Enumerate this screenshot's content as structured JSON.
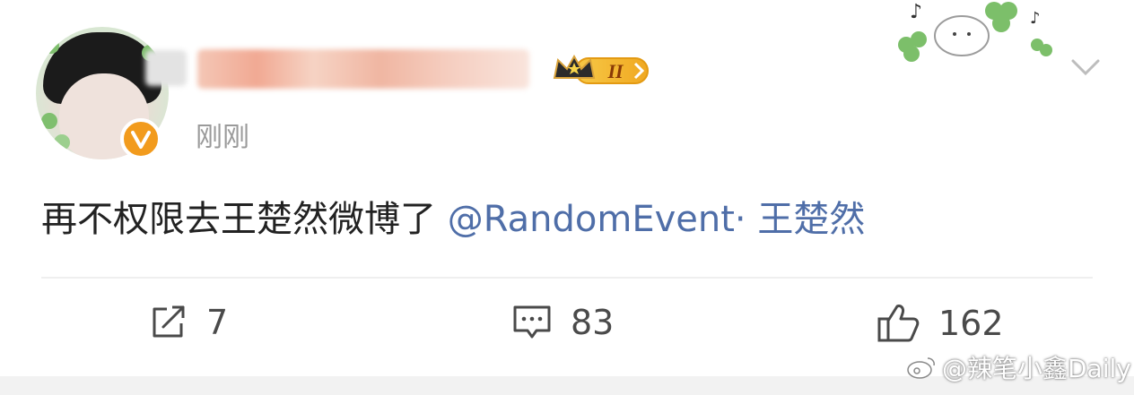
{
  "post": {
    "time": "刚刚",
    "badge_level": "II",
    "content_text": "再不权限去王楚然微博了",
    "mention": "@RandomEvent· 王楚然",
    "actions": {
      "repost_count": "7",
      "comment_count": "83",
      "like_count": "162"
    }
  },
  "watermark": "@辣笔小鑫Daily",
  "icons": {
    "verified": "verified-badge-icon",
    "crown": "crown-icon",
    "chevron": "chevron-down-icon",
    "repost": "repost-icon",
    "comment": "comment-icon",
    "like": "thumbs-up-icon",
    "weibo": "weibo-logo-icon"
  },
  "colors": {
    "mention": "#4f6ea8",
    "verified": "#f29b1d",
    "badge": "#f2b531"
  }
}
